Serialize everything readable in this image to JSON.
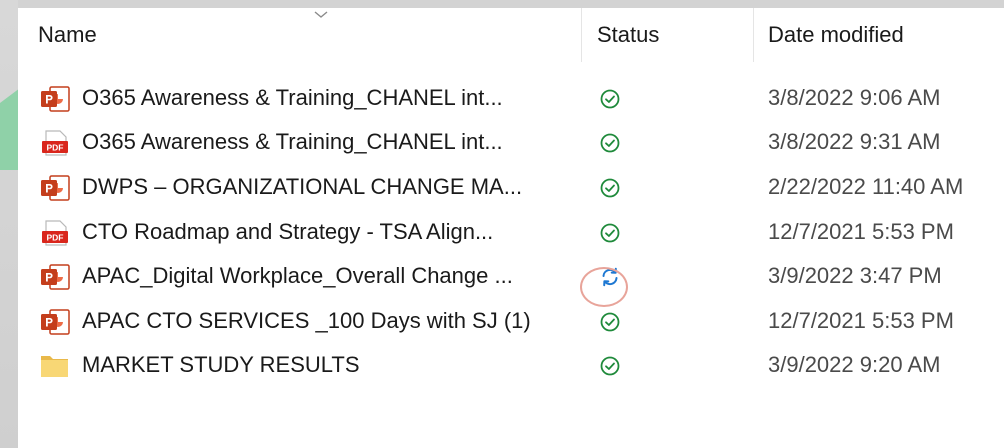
{
  "header": {
    "name": "Name",
    "status": "Status",
    "date_modified": "Date modified"
  },
  "rows": [
    {
      "name": "O365 Awareness & Training_CHANEL int...",
      "date": "3/8/2022 9:06 AM",
      "type": "powerpoint-icon",
      "status": "synced-check-icon"
    },
    {
      "name": "O365 Awareness & Training_CHANEL int...",
      "date": "3/8/2022 9:31 AM",
      "type": "pdf-icon",
      "status": "synced-check-icon"
    },
    {
      "name": "DWPS – ORGANIZATIONAL CHANGE MA...",
      "date": "2/22/2022 11:40 AM",
      "type": "powerpoint-icon",
      "status": "synced-check-icon"
    },
    {
      "name": "CTO Roadmap and Strategy - TSA Align...",
      "date": "12/7/2021 5:53 PM",
      "type": "pdf-icon",
      "status": "synced-check-icon"
    },
    {
      "name": "APAC_Digital Workplace_Overall Change ...",
      "date": "3/9/2022 3:47 PM",
      "type": "powerpoint-icon",
      "status": "sync-pending-icon"
    },
    {
      "name": "APAC CTO SERVICES _100 Days with SJ (1)",
      "date": "12/7/2021 5:53 PM",
      "type": "powerpoint-icon",
      "status": "synced-check-icon"
    },
    {
      "name": "MARKET STUDY RESULTS",
      "date": "3/9/2022 9:20 AM",
      "type": "folder-icon",
      "status": "synced-check-icon"
    }
  ],
  "colors": {
    "powerpoint": "#c43e1c",
    "pdf": "#d9261c",
    "folder": "#f8d775",
    "synced": "#1f8a3b",
    "syncing": "#1e78d2",
    "highlight": "#e8a49a",
    "accent_green": "#8fd1a8"
  }
}
